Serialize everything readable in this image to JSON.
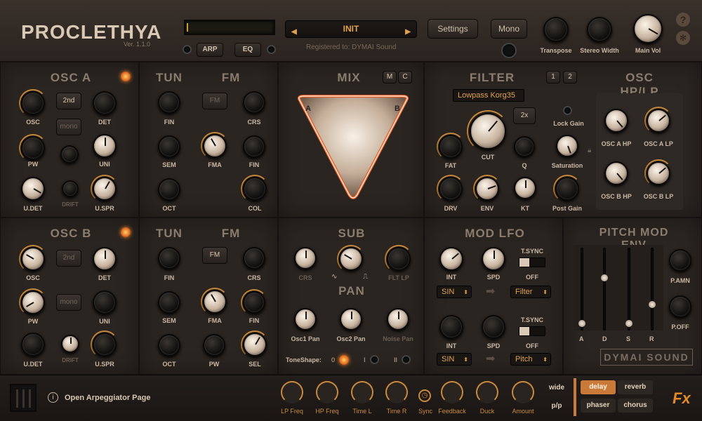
{
  "header": {
    "logo": "PROCLETHYA",
    "version": "Ver. 1.1.0",
    "arp": "ARP",
    "eq": "EQ",
    "preset": "INIT",
    "registered": "Registered to: DYMAI Sound",
    "settings": "Settings",
    "mono": "Mono",
    "transpose": "Transpose",
    "stereo_width": "Stereo Width",
    "main_vol": "Main Vol",
    "help": "?"
  },
  "osca": {
    "title": "OSC A",
    "second": "2nd",
    "mono": "mono",
    "osc": "OSC",
    "det": "DET",
    "pw": "PW",
    "uni": "UNI",
    "udet": "U.DET",
    "drift": "DRIFT",
    "uspr": "U.SPR"
  },
  "oscb": {
    "title": "OSC B",
    "second": "2nd",
    "mono": "mono",
    "osc": "OSC",
    "det": "DET",
    "pw": "PW",
    "uni": "UNI",
    "udet": "U.DET",
    "drift": "DRIFT",
    "uspr": "U.SPR"
  },
  "tuna": {
    "tun": "TUN",
    "fm": "FM",
    "fmbtn": "FM",
    "fin": "FIN",
    "crs": "CRS",
    "sem": "SEM",
    "fma": "FMA",
    "fin2": "FIN",
    "oct": "OCT",
    "col": "COL"
  },
  "tunb": {
    "tun": "TUN",
    "fm": "FM",
    "fmbtn": "FM",
    "fin": "FIN",
    "crs": "CRS",
    "sem": "SEM",
    "fma": "FMA",
    "fin2": "FIN",
    "oct": "OCT",
    "pw": "PW",
    "sel": "SEL"
  },
  "mix": {
    "title": "MIX",
    "m": "M",
    "c": "C",
    "a": "A",
    "b": "B"
  },
  "sub": {
    "title": "SUB",
    "crs": "CRS",
    "flt": "FLT LP",
    "pan": "PAN",
    "osc1pan": "Osc1 Pan",
    "osc2pan": "Osc2 Pan",
    "noisepan": "Noise Pan",
    "toneshape": "ToneShape:",
    "ts0": "0",
    "tsi": "I",
    "tsii": "II"
  },
  "filter": {
    "title": "FILTER",
    "b1": "1",
    "b2": "2",
    "type": "Lowpass Korg35",
    "x2": "2x",
    "lockgain": "Lock Gain",
    "fat": "FAT",
    "cut": "CUT",
    "q": "Q",
    "saturation": "Saturation",
    "drv": "DRV",
    "env": "ENV",
    "kt": "KT",
    "postgain": "Post Gain"
  },
  "hplp": {
    "title": "OSC HP/LP",
    "ahp": "OSC A HP",
    "alp": "OSC A LP",
    "bhp": "OSC B HP",
    "blp": "OSC B LP"
  },
  "lfo": {
    "title": "MOD LFO",
    "int": "INT",
    "spd": "SPD",
    "tsync": "T.SYNC",
    "off": "OFF",
    "wave1": "SIN",
    "dest1": "Filter",
    "wave2": "SIN",
    "dest2": "Pitch"
  },
  "penv": {
    "title": "PITCH MOD ENV",
    "a": "A",
    "d": "D",
    "s": "S",
    "r": "R",
    "pamn": "P.AMN",
    "poff": "P.OFF",
    "brand": "DYMAI SOUND",
    "levels": {
      "a": 0.05,
      "d": 0.65,
      "s": 0.05,
      "r": 0.3
    }
  },
  "footer": {
    "arp_link": "Open Arpeggiator Page",
    "lp": "LP Freq",
    "hp": "HP Freq",
    "timel": "Time L",
    "timer": "Time R",
    "sync": "Sync",
    "feedback": "Feedback",
    "duck": "Duck",
    "amount": "Amount",
    "wide": "wide",
    "pp": "p/p",
    "delay": "delay",
    "reverb": "reverb",
    "phaser": "phaser",
    "chorus": "chorus",
    "fx": "Fx"
  },
  "colors": {
    "accent": "#c98a3e",
    "preset": "#e0a24a"
  }
}
